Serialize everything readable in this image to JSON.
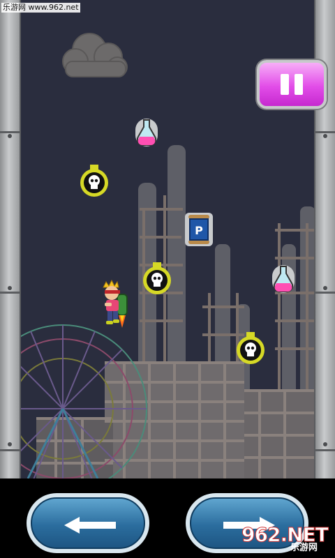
{
  "watermark": {
    "text": "乐游网 www.962.net"
  },
  "hud": {
    "pause_icon": "pause-icon"
  },
  "controls": {
    "left_icon": "arrow-left-icon",
    "right_icon": "arrow-right-icon"
  },
  "logo": {
    "text": "962.NET",
    "subtitle": "乐游网"
  },
  "colors": {
    "sky": "#2a2d3e",
    "pause": "#e24de8",
    "hazard": "#d6d926",
    "potion": "#ff4fb3",
    "control": "#2b6d9e"
  },
  "items": [
    {
      "type": "potion",
      "icon": "potion-icon"
    },
    {
      "type": "skull-bomb",
      "icon": "skull-bomb-icon"
    },
    {
      "type": "power-up-scroll",
      "icon": "scroll-icon",
      "label": "P"
    },
    {
      "type": "skull-bomb",
      "icon": "skull-bomb-icon"
    },
    {
      "type": "potion",
      "icon": "potion-icon"
    },
    {
      "type": "skull-bomb",
      "icon": "skull-bomb-icon"
    }
  ]
}
